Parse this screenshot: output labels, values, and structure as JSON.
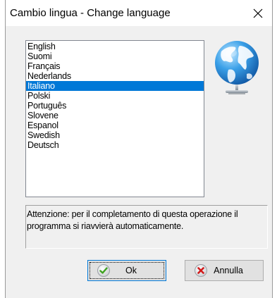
{
  "window": {
    "title": "Cambio lingua - Change language"
  },
  "languages": {
    "items": [
      "English",
      "Suomi",
      "Français",
      "Nederlands",
      "Italiano",
      "Polski",
      "Português",
      "Slovene",
      "Espanol",
      "Swedish",
      "Deutsch"
    ],
    "selected": "Italiano"
  },
  "message": {
    "text": "Attenzione: per il completamento di questa operazione il programma si riavvierà automaticamente."
  },
  "buttons": {
    "ok_label": "Ok",
    "cancel_label": "Annulla"
  },
  "icons": {
    "close": "close-icon",
    "globe": "globe-icon",
    "ok": "checkmark-icon",
    "cancel": "x-icon"
  },
  "colors": {
    "selection": "#0078d7",
    "dialog_background": "#f0f0f0"
  }
}
